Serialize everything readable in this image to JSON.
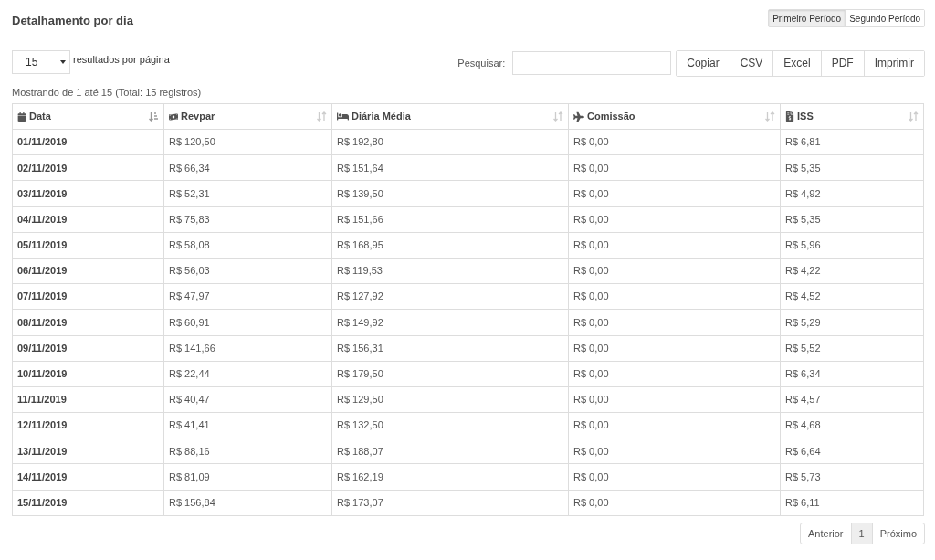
{
  "title": "Detalhamento por dia",
  "periods": [
    {
      "label": "Primeiro Período",
      "selected": true
    },
    {
      "label": "Segundo Período",
      "selected": false
    }
  ],
  "page_length": {
    "value": "15",
    "label": "resultados por página"
  },
  "search": {
    "label": "Pesquisar:"
  },
  "export_buttons": [
    "Copiar",
    "CSV",
    "Excel",
    "PDF",
    "Imprimir"
  ],
  "info": "Mostrando de 1 até 15 (Total: 15 registros)",
  "table": {
    "columns": [
      {
        "label": "Data",
        "sorted": true
      },
      {
        "label": "Revpar",
        "sorted": false
      },
      {
        "label": "Diária Média",
        "sorted": false
      },
      {
        "label": "Comissão",
        "sorted": false
      },
      {
        "label": "ISS",
        "sorted": false
      }
    ],
    "rows": [
      [
        "01/11/2019",
        "R$ 120,50",
        "R$ 192,80",
        "R$ 0,00",
        "R$ 6,81"
      ],
      [
        "02/11/2019",
        "R$ 66,34",
        "R$ 151,64",
        "R$ 0,00",
        "R$ 5,35"
      ],
      [
        "03/11/2019",
        "R$ 52,31",
        "R$ 139,50",
        "R$ 0,00",
        "R$ 4,92"
      ],
      [
        "04/11/2019",
        "R$ 75,83",
        "R$ 151,66",
        "R$ 0,00",
        "R$ 5,35"
      ],
      [
        "05/11/2019",
        "R$ 58,08",
        "R$ 168,95",
        "R$ 0,00",
        "R$ 5,96"
      ],
      [
        "06/11/2019",
        "R$ 56,03",
        "R$ 119,53",
        "R$ 0,00",
        "R$ 4,22"
      ],
      [
        "07/11/2019",
        "R$ 47,97",
        "R$ 127,92",
        "R$ 0,00",
        "R$ 4,52"
      ],
      [
        "08/11/2019",
        "R$ 60,91",
        "R$ 149,92",
        "R$ 0,00",
        "R$ 5,29"
      ],
      [
        "09/11/2019",
        "R$ 141,66",
        "R$ 156,31",
        "R$ 0,00",
        "R$ 5,52"
      ],
      [
        "10/11/2019",
        "R$ 22,44",
        "R$ 179,50",
        "R$ 0,00",
        "R$ 6,34"
      ],
      [
        "11/11/2019",
        "R$ 40,47",
        "R$ 129,50",
        "R$ 0,00",
        "R$ 4,57"
      ],
      [
        "12/11/2019",
        "R$ 41,41",
        "R$ 132,50",
        "R$ 0,00",
        "R$ 4,68"
      ],
      [
        "13/11/2019",
        "R$ 88,16",
        "R$ 188,07",
        "R$ 0,00",
        "R$ 6,64"
      ],
      [
        "14/11/2019",
        "R$ 81,09",
        "R$ 162,19",
        "R$ 0,00",
        "R$ 5,73"
      ],
      [
        "15/11/2019",
        "R$ 156,84",
        "R$ 173,07",
        "R$ 0,00",
        "R$ 6,11"
      ]
    ]
  },
  "pagination": {
    "previous": "Anterior",
    "pages": [
      {
        "label": "1",
        "selected": true
      }
    ],
    "next": "Próximo"
  }
}
